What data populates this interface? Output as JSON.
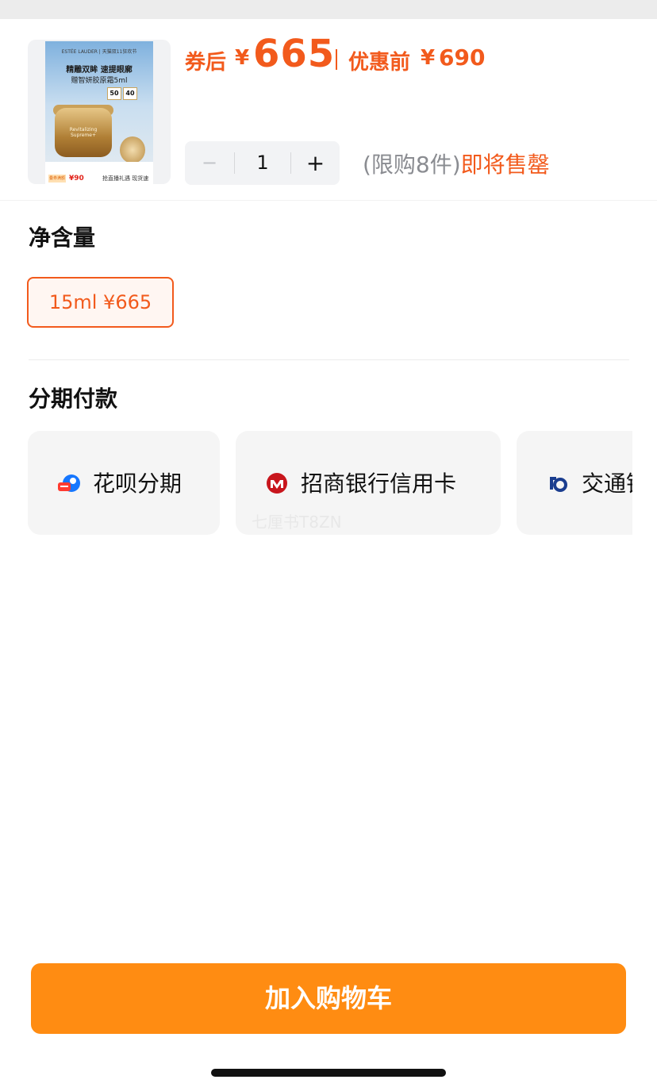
{
  "product": {
    "image_text": {
      "brand_line": "ESTÉE LAUDER  |  天猫双11狂欢节",
      "headline": "精雕双眸 速提眼廓",
      "gift": "赠智妍胶原霜5ml",
      "badge_1": "50",
      "badge_2": "40",
      "jar_text": "Revitalizing Supreme+",
      "footer_tag": "叠券满额",
      "footer_value": "¥90",
      "footer_text": "抢直播礼遇 现货速发!"
    },
    "coupon_price_label": "券后",
    "currency": "¥",
    "coupon_price": "665",
    "original_price_label": "优惠前",
    "original_price": "690"
  },
  "quantity": {
    "minus_label": "−",
    "value": "1",
    "plus_label": "+",
    "limit_text": "(限购8件)",
    "stock_text": "即将售罄"
  },
  "spec": {
    "title": "净含量",
    "options": [
      {
        "label": "15ml  ¥665",
        "selected": true
      }
    ]
  },
  "installment": {
    "title": "分期付款",
    "options": [
      {
        "label": "花呗分期",
        "icon": "huabei-icon"
      },
      {
        "label": "招商银行信用卡",
        "icon": "cmb-icon"
      },
      {
        "label": "交通银行信用卡",
        "icon": "bocom-icon"
      }
    ]
  },
  "watermark": "七厘书T8ZN",
  "actions": {
    "add_to_cart": "加入购物车"
  },
  "colors": {
    "accent": "#f25a1c",
    "button": "#ff8c12"
  }
}
